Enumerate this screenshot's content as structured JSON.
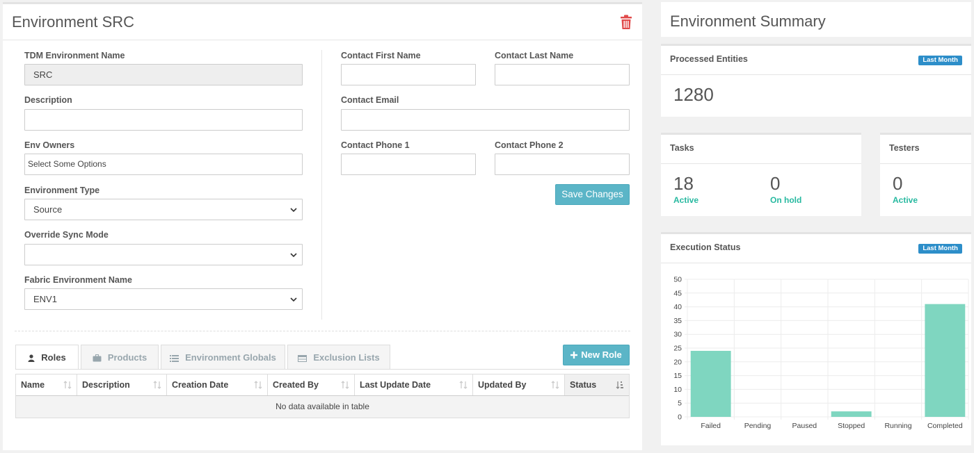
{
  "main": {
    "title": "Environment SRC",
    "form": {
      "tdm_env_name_label": "TDM Environment Name",
      "tdm_env_name_value": "SRC",
      "description_label": "Description",
      "description_value": "",
      "env_owners_label": "Env Owners",
      "env_owners_placeholder": "Select Some Options",
      "env_type_label": "Environment Type",
      "env_type_value": "Source",
      "override_sync_label": "Override Sync Mode",
      "override_sync_value": "",
      "fabric_env_label": "Fabric Environment Name",
      "fabric_env_value": "ENV1",
      "contact_first_label": "Contact First Name",
      "contact_last_label": "Contact Last Name",
      "contact_email_label": "Contact Email",
      "contact_phone1_label": "Contact Phone 1",
      "contact_phone2_label": "Contact Phone 2",
      "save_label": "Save Changes"
    },
    "tabs": [
      {
        "label": "Roles",
        "icon": "user-icon",
        "active": true
      },
      {
        "label": "Products",
        "icon": "briefcase-icon",
        "active": false
      },
      {
        "label": "Environment Globals",
        "icon": "list-icon",
        "active": false
      },
      {
        "label": "Exclusion Lists",
        "icon": "table-icon",
        "active": false
      }
    ],
    "new_role_label": "New Role",
    "table": {
      "columns": [
        "Name",
        "Description",
        "Creation Date",
        "Created By",
        "Last Update Date",
        "Updated By",
        "Status"
      ],
      "empty_text": "No data available in table"
    }
  },
  "summary": {
    "title": "Environment Summary",
    "processed": {
      "title": "Processed Entities",
      "badge": "Last Month",
      "value": "1280"
    },
    "tasks": {
      "title": "Tasks",
      "active_value": "18",
      "active_label": "Active",
      "onhold_value": "0",
      "onhold_label": "On hold"
    },
    "testers": {
      "title": "Testers",
      "active_value": "0",
      "active_label": "Active"
    },
    "execution": {
      "title": "Execution Status",
      "badge": "Last Month"
    }
  },
  "colors": {
    "accent": "#5bb5c7",
    "bar": "#7fd6c0",
    "badge": "#2d8ec9",
    "trash": "#e04a4a",
    "active_text": "#27b9a0"
  },
  "chart_data": {
    "type": "bar",
    "categories": [
      "Failed",
      "Pending",
      "Paused",
      "Stopped",
      "Running",
      "Completed"
    ],
    "values": [
      24,
      0,
      0,
      2,
      0,
      41
    ],
    "ylim": [
      0,
      50
    ],
    "yticks": [
      0,
      5,
      10,
      15,
      20,
      25,
      30,
      35,
      40,
      45,
      50
    ],
    "grid": true
  }
}
